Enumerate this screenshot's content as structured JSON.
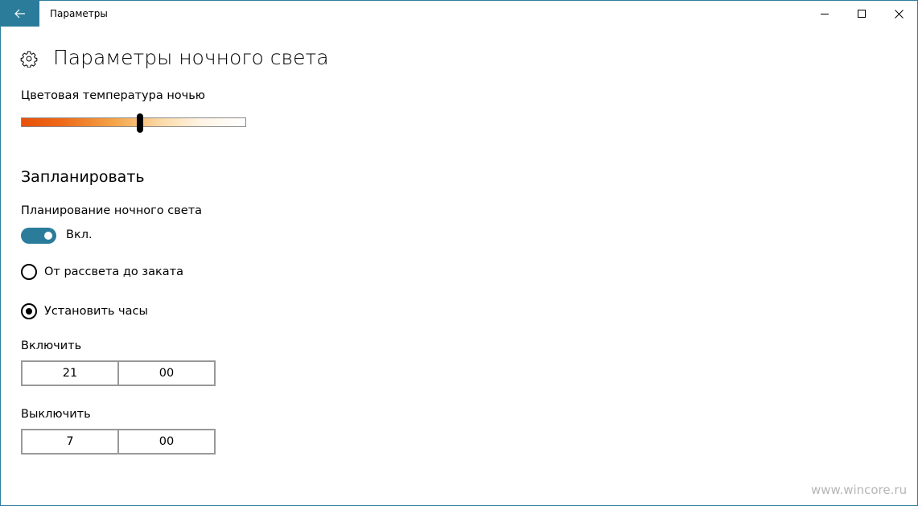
{
  "window": {
    "title": "Параметры"
  },
  "header": {
    "title": "Параметры ночного света",
    "icon": "gear-icon"
  },
  "color_temperature": {
    "label": "Цветовая температура ночью",
    "level": 0.53
  },
  "schedule": {
    "heading": "Запланировать",
    "label": "Планирование ночного света",
    "toggle_state": "Вкл.",
    "toggle_on": true,
    "options": [
      {
        "label": "От рассвета до заката",
        "selected": false
      },
      {
        "label": "Установить часы",
        "selected": true
      }
    ]
  },
  "turn_on": {
    "label": "Включить",
    "hour": "21",
    "minute": "00"
  },
  "turn_off": {
    "label": "Выключить",
    "hour": "7",
    "minute": "00"
  },
  "watermark": "www.wincore.ru",
  "colors": {
    "accent": "#2b7c9b",
    "slider_warm": "#e8500a"
  }
}
